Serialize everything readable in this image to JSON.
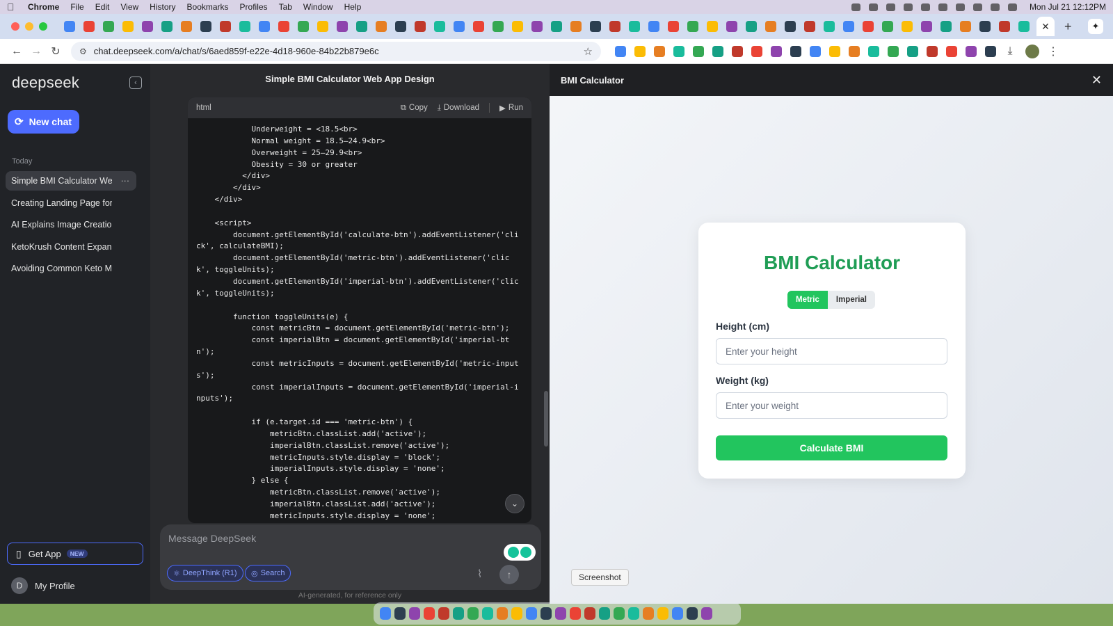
{
  "menubar": {
    "app": "Chrome",
    "items": [
      "File",
      "Edit",
      "View",
      "History",
      "Bookmarks",
      "Profiles",
      "Tab",
      "Window",
      "Help"
    ],
    "clock": "Mon Jul 21  12:12PM"
  },
  "browser": {
    "url": "chat.deepseek.com/a/chat/s/6aed859f-e22e-4d18-960e-84b22b879e6c",
    "active_tab_close": "✕",
    "new_tab": "+"
  },
  "sidebar": {
    "logo": "deepseek",
    "new_chat": "New chat",
    "section": "Today",
    "chats": [
      "Simple BMI Calculator We",
      "Creating Landing Page for Tub",
      "AI Explains Image Creation Lim",
      "KetoKrush Content Expansion",
      "Avoiding Common Keto Mistak"
    ],
    "get_app": "Get App",
    "get_app_badge": "NEW",
    "profile_initial": "D",
    "profile": "My Profile"
  },
  "chat": {
    "title": "Simple BMI Calculator Web App Design",
    "code_lang": "html",
    "copy": "Copy",
    "download": "Download",
    "run": "Run",
    "code_lines": [
      "            Underweight = <18.5<br>",
      "            Normal weight = 18.5–24.9<br>",
      "            Overweight = 25–29.9<br>",
      "            Obesity = 30 or greater",
      "          </div>",
      "        </div>",
      "    </div>",
      "",
      "    <script>",
      "        document.getElementById('calculate-btn').addEventListener('click', calculateBMI);",
      "        document.getElementById('metric-btn').addEventListener('click', toggleUnits);",
      "        document.getElementById('imperial-btn').addEventListener('click', toggleUnits);",
      "",
      "        function toggleUnits(e) {",
      "            const metricBtn = document.getElementById('metric-btn');",
      "            const imperialBtn = document.getElementById('imperial-btn');",
      "            const metricInputs = document.getElementById('metric-inputs');",
      "            const imperialInputs = document.getElementById('imperial-inputs');",
      "",
      "            if (e.target.id === 'metric-btn') {",
      "                metricBtn.classList.add('active');",
      "                imperialBtn.classList.remove('active');",
      "                metricInputs.style.display = 'block';",
      "                imperialInputs.style.display = 'none';",
      "            } else {",
      "                metricBtn.classList.remove('active');",
      "                imperialBtn.classList.add('active');",
      "                metricInputs.style.display = 'none';",
      "                imperialInputs.style.display = 'block';",
      "            }"
    ],
    "input_placeholder": "Message DeepSeek",
    "deepthink": "DeepThink (R1)",
    "search": "Search",
    "disclaimer": "AI-generated, for reference only"
  },
  "preview": {
    "title": "BMI Calculator",
    "heading": "BMI Calculator",
    "metric": "Metric",
    "imperial": "Imperial",
    "height_label": "Height (cm)",
    "height_placeholder": "Enter your height",
    "weight_label": "Weight (kg)",
    "weight_placeholder": "Enter your weight",
    "calculate": "Calculate BMI",
    "tooltip": "Screenshot"
  },
  "colors": {
    "deepseek_blue": "#4d6bfe",
    "bmi_green": "#22c55e",
    "heading_green": "#1f9d55"
  }
}
